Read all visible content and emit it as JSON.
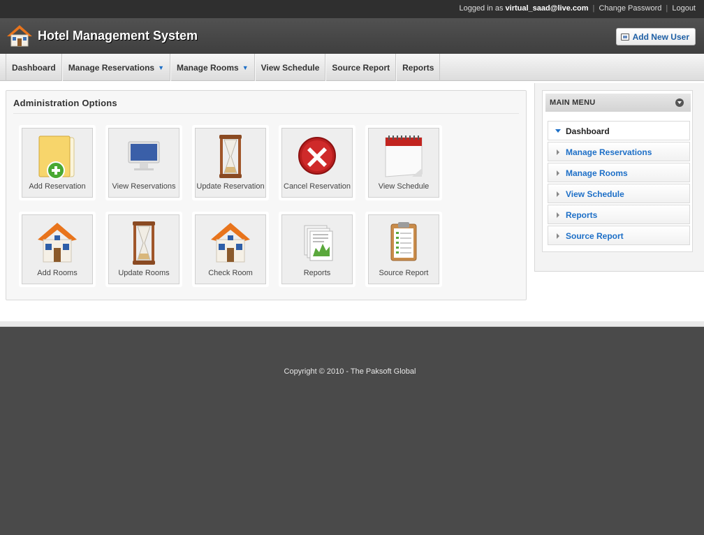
{
  "topbar": {
    "logged_in_prefix": "Logged in as",
    "username": "virtual_saad@live.com",
    "change_password": "Change Password",
    "logout": "Logout",
    "separator": "|"
  },
  "header": {
    "title": "Hotel Management System",
    "add_user_label": "Add New User"
  },
  "nav": {
    "items": [
      {
        "label": "Dashboard"
      },
      {
        "label": "Manage Reservations",
        "dropdown": "⌄"
      },
      {
        "label": "Manage Rooms",
        "dropdown": "⌄"
      },
      {
        "label": "View Schedule"
      },
      {
        "label": "Source Report"
      },
      {
        "label": "Reports"
      }
    ]
  },
  "admin": {
    "title": "Administration Options",
    "tiles": [
      {
        "label": "Add Reservation",
        "icon": "folder-add-icon"
      },
      {
        "label": "View Reservations",
        "icon": "monitor-icon"
      },
      {
        "label": "Update Reservation",
        "icon": "hourglass-icon"
      },
      {
        "label": "Cancel Reservation",
        "icon": "cancel-x-icon"
      },
      {
        "label": "View Schedule",
        "icon": "calendar-icon"
      },
      {
        "label": "Add Rooms",
        "icon": "house-icon"
      },
      {
        "label": "Update Rooms",
        "icon": "hourglass-icon"
      },
      {
        "label": "Check Room",
        "icon": "house-icon"
      },
      {
        "label": "Reports",
        "icon": "reports-icon"
      },
      {
        "label": "Source Report",
        "icon": "clipboard-icon"
      }
    ]
  },
  "sidebar": {
    "heading": "MAIN MENU",
    "items": [
      {
        "label": "Dashboard",
        "active": true
      },
      {
        "label": "Manage Reservations"
      },
      {
        "label": "Manage Rooms"
      },
      {
        "label": "View Schedule"
      },
      {
        "label": "Reports"
      },
      {
        "label": "Source Report"
      }
    ]
  },
  "footer": {
    "copyright": "Copyright © 2010 - The Paksoft Global"
  },
  "colors": {
    "header_bg": "#474747",
    "link_blue": "#1d6fc7",
    "footer_bg": "#4a4a4a"
  }
}
